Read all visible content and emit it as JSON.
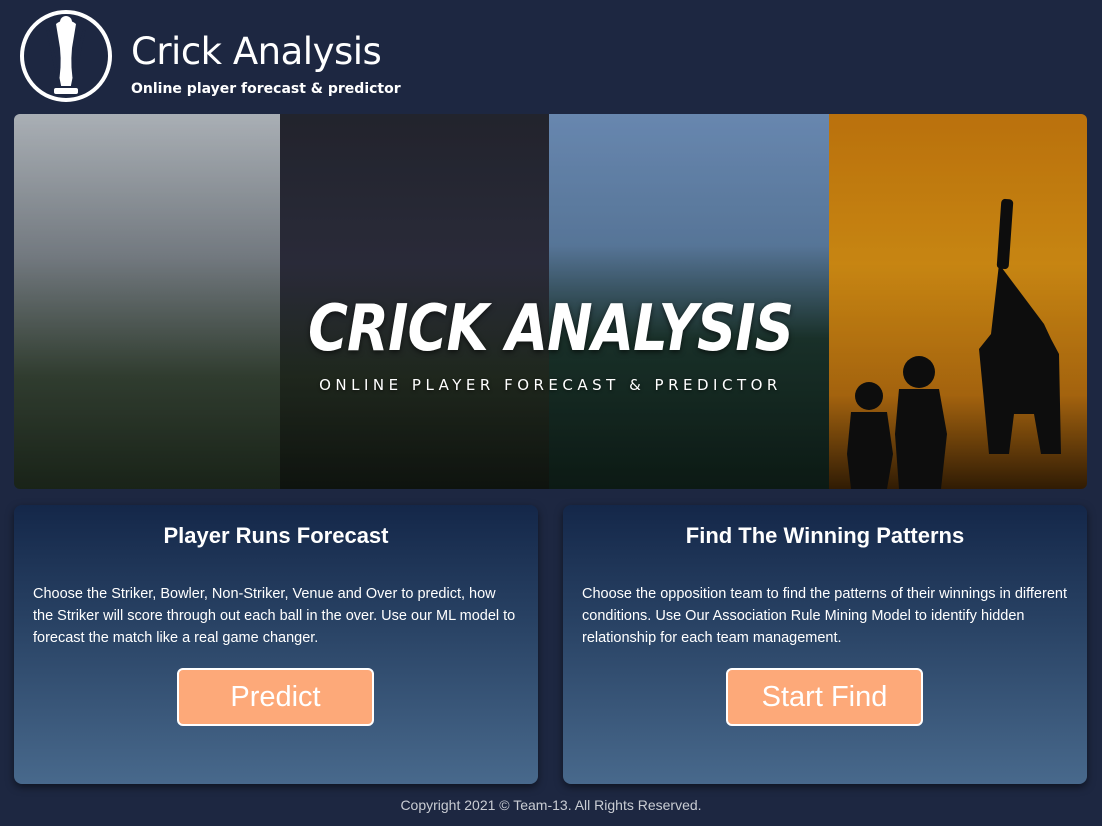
{
  "header": {
    "title": "Crick Analysis",
    "subtitle": "Online player forecast & predictor",
    "logo_icon": "trophy-logo-icon"
  },
  "banner": {
    "title": "CRICK ANALYSIS",
    "tagline": "ONLINE PLAYER FORECAST & PREDICTOR"
  },
  "cards": [
    {
      "title": "Player Runs Forecast",
      "description": "Choose the Striker, Bowler, Non-Striker, Venue and Over to predict, how the Striker will score through out each ball in the over. Use our ML model to forecast the match like a real game changer.",
      "button": "Predict"
    },
    {
      "title": "Find The Winning Patterns",
      "description": "Choose the opposition team to find the patterns of their winnings in different conditions. Use Our Association Rule Mining Model to identify hidden relationship for each team management.",
      "button": "Start Find"
    }
  ],
  "footer": {
    "text": "Copyright 2021 © Team-13. All Rights Reserved."
  },
  "colors": {
    "background": "#1d2741",
    "button": "#fda979",
    "card_top": "#142749",
    "card_bottom": "#48698c"
  }
}
